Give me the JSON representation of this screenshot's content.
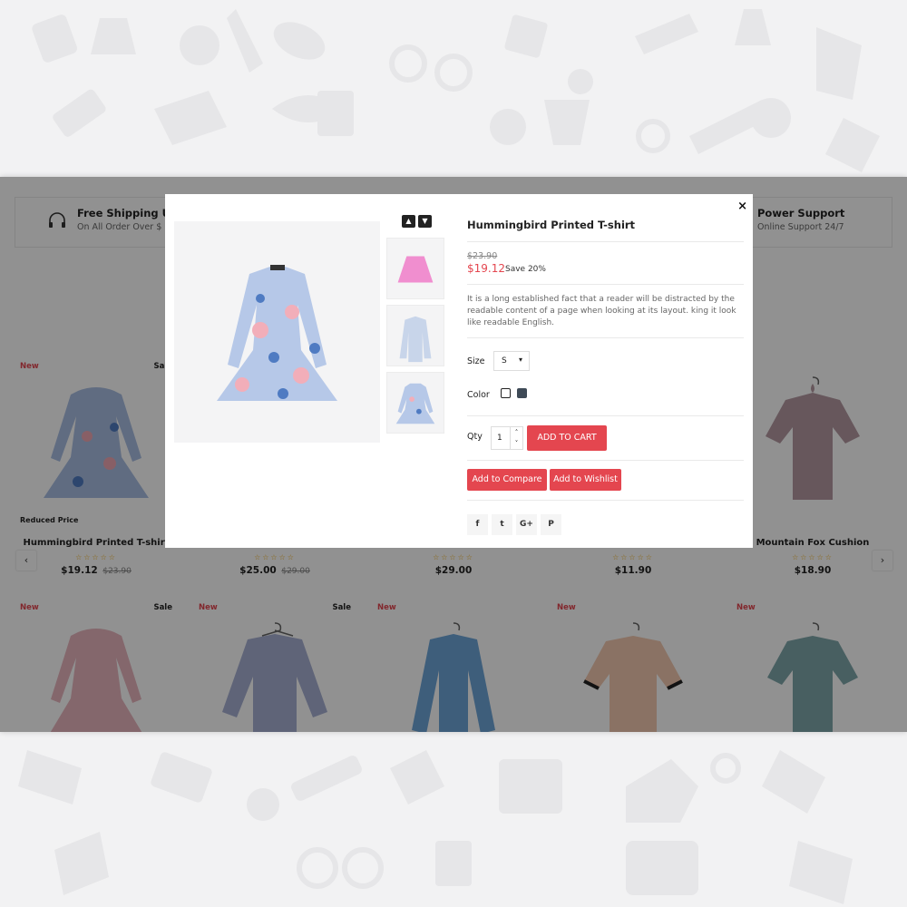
{
  "services": [
    {
      "title": "Free Shipping US",
      "sub": "On All Order Over $",
      "icon": "headset-icon"
    },
    {
      "title": "Power Support",
      "sub": "Online Support 24/7",
      "icon": "support-icon"
    }
  ],
  "products_row1": [
    {
      "badge_new": "New",
      "badge_sale": "Sale",
      "reduced": "Reduced Price",
      "name": "Hummingbird Printed T-shirt",
      "stars": "☆☆☆☆☆",
      "price": "$19.12",
      "old_price": "$23.90"
    },
    {
      "badge_new": "",
      "badge_sale": "",
      "name": "",
      "stars": "☆☆☆☆☆",
      "price": "$25.00",
      "old_price": "$29.00"
    },
    {
      "badge_new": "",
      "badge_sale": "",
      "name": "",
      "stars": "☆☆☆☆☆",
      "price": "$29.00",
      "old_price": ""
    },
    {
      "badge_new": "",
      "badge_sale": "",
      "name": "",
      "stars": "☆☆☆☆☆",
      "price": "$11.90",
      "old_price": ""
    },
    {
      "badge_new": "",
      "badge_sale": "",
      "name": "Mountain Fox Cushion",
      "stars": "☆☆☆☆☆",
      "price": "$18.90",
      "old_price": ""
    }
  ],
  "products_row2": [
    {
      "badge_new": "New",
      "badge_sale": "Sale"
    },
    {
      "badge_new": "New",
      "badge_sale": "Sale"
    },
    {
      "badge_new": "New",
      "badge_sale": ""
    },
    {
      "badge_new": "New",
      "badge_sale": ""
    },
    {
      "badge_new": "New",
      "badge_sale": ""
    }
  ],
  "carousel": {
    "prev": "‹",
    "next": "›"
  },
  "modal": {
    "close": "×",
    "thumb_up": "▲",
    "thumb_down": "▼",
    "title": "Hummingbird Printed T-shirt",
    "old_price": "$23.90",
    "price": "$19.12",
    "save": "Save 20%",
    "description": "It is a long established fact that a reader will be distracted by the readable content of a page when looking at its layout. king it look like readable English.",
    "size_label": "Size",
    "size_value": "S",
    "color_label": "Color",
    "colors": [
      "#ffffff",
      "#3e4a56"
    ],
    "qty_label": "Qty",
    "qty_value": "1",
    "add_to_cart": "ADD TO CART",
    "add_to_compare": "Add to Compare",
    "add_to_wishlist": "Add to Wishlist",
    "social": [
      "f",
      "t",
      "G+",
      "P"
    ],
    "accent": "#e4464f"
  }
}
